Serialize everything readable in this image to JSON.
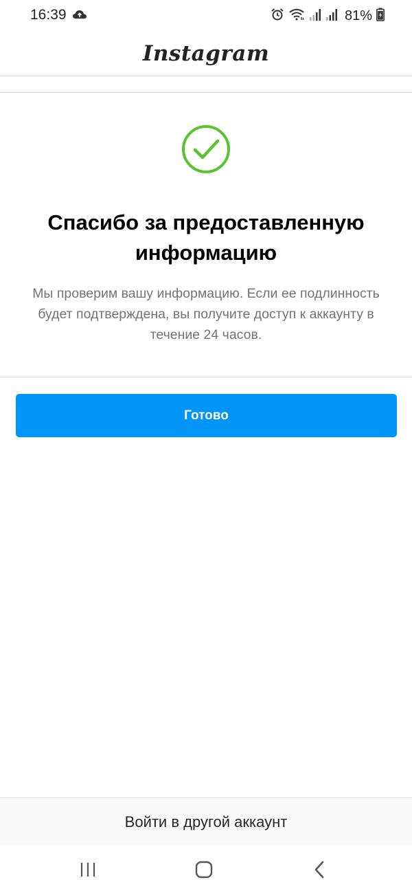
{
  "status_bar": {
    "time": "16:39",
    "battery_percent": "81%",
    "icons": [
      "cloud-icon",
      "alarm-icon",
      "wifi-icon",
      "signal-icon",
      "signal-icon",
      "battery-charging-icon"
    ]
  },
  "header": {
    "logo_text": "Instagram"
  },
  "confirmation": {
    "icon": "check-circle-icon",
    "icon_color": "#5ac32d",
    "title": "Спасибо за предоставленную информацию",
    "description": "Мы проверим вашу информацию. Если ее подлинность будет подтверждена, вы получите доступ к аккаунту в течение 24 часов."
  },
  "actions": {
    "done_label": "Готово",
    "done_color": "#0095f6"
  },
  "footer": {
    "switch_account_label": "Войти в другой аккаунт"
  },
  "nav_bar": {
    "icons": [
      "recents-icon",
      "home-icon",
      "back-icon"
    ]
  }
}
